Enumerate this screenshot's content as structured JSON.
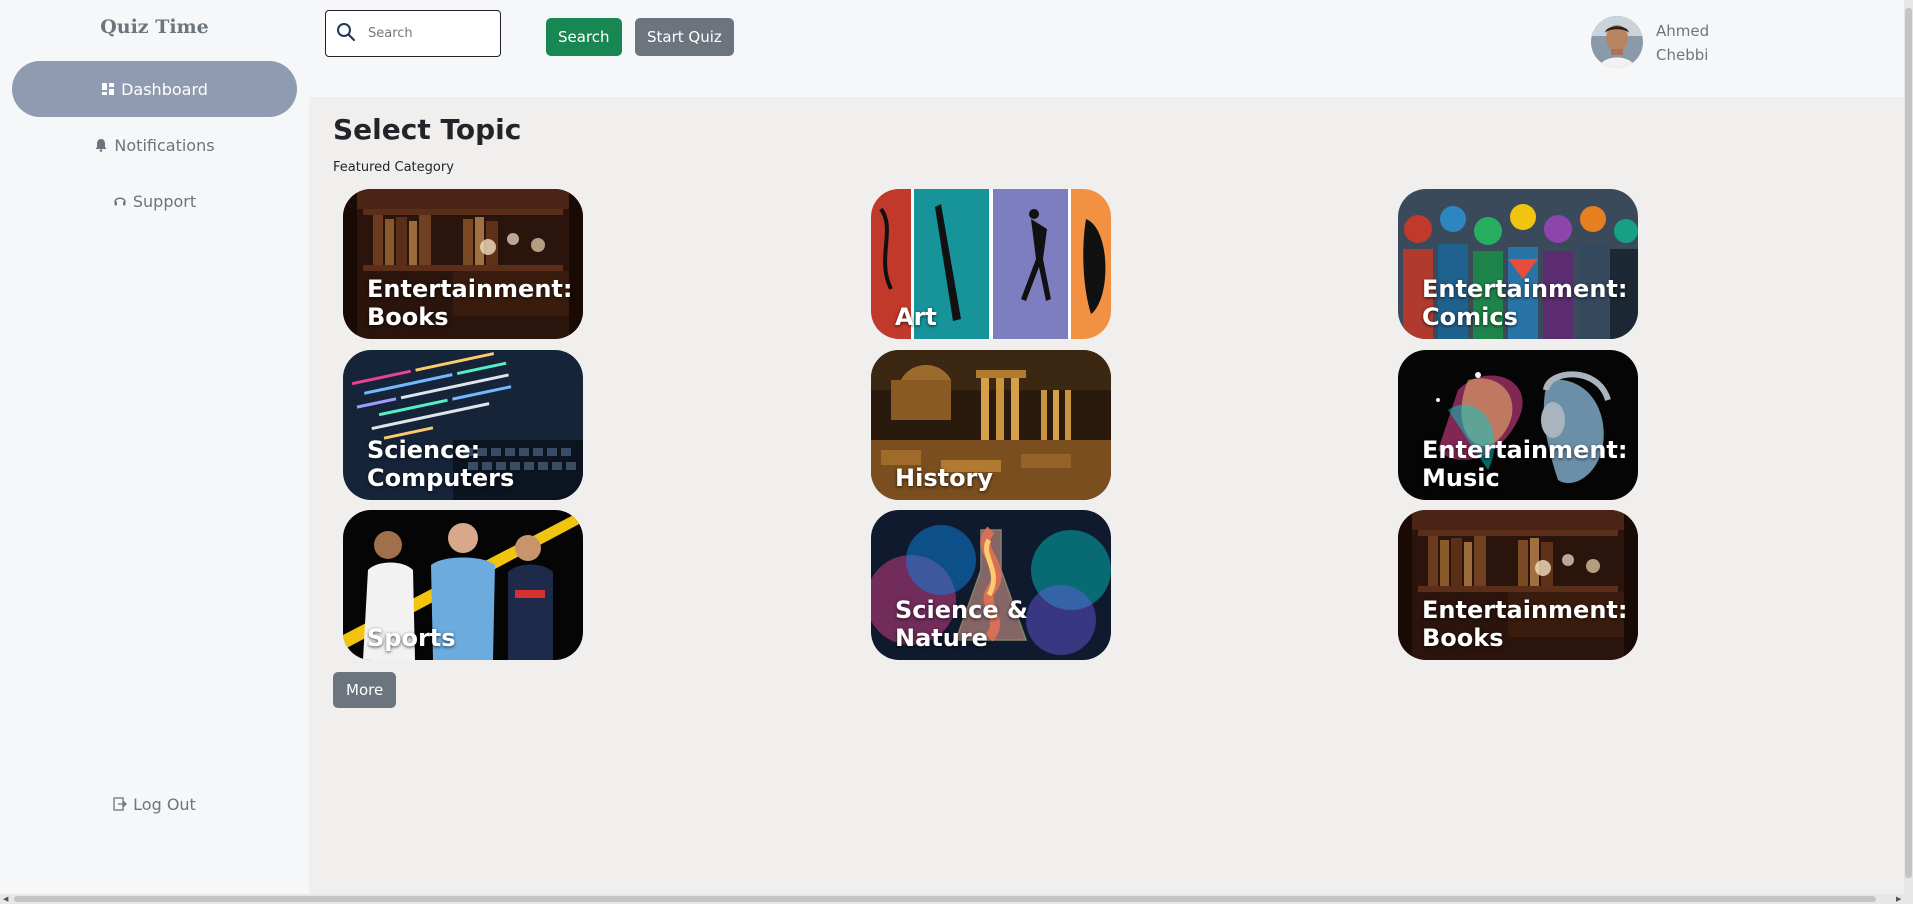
{
  "sidebar": {
    "brand": "Quiz Time",
    "items": [
      {
        "label": "Dashboard",
        "icon": "dashboard-icon",
        "active": true
      },
      {
        "label": "Notifications",
        "icon": "bell-icon"
      },
      {
        "label": "Support",
        "icon": "headset-icon"
      }
    ],
    "logout": {
      "label": "Log Out",
      "icon": "logout-icon"
    }
  },
  "header": {
    "search_placeholder": "Search",
    "search_button": "Search",
    "start_button": "Start Quiz",
    "user": {
      "first_name": "Ahmed",
      "last_name": "Chebbi",
      "avatar": "user-avatar"
    }
  },
  "main": {
    "title": "Select Topic",
    "subtitle": "Featured Category",
    "categories": [
      {
        "label": "Entertainment: Books",
        "image": "bookshelf-image"
      },
      {
        "label": "Art",
        "image": "art-panels-image"
      },
      {
        "label": "Entertainment: Comics",
        "image": "comic-heroes-image"
      },
      {
        "label": "Science: Computers",
        "image": "code-screen-image"
      },
      {
        "label": "History",
        "image": "ancient-ruins-image"
      },
      {
        "label": "Entertainment: Music",
        "image": "headphones-art-image"
      },
      {
        "label": "Sports",
        "image": "football-players-image"
      },
      {
        "label": "Science & Nature",
        "image": "chemistry-flask-image"
      },
      {
        "label": "Entertainment: Books",
        "image": "bookshelf-image"
      }
    ],
    "more_button": "More"
  },
  "colors": {
    "sidebar_bg": "#f6f7f9",
    "main_bg": "#f0efed",
    "active_nav": "#8e9bb0",
    "search_button": "#198754",
    "secondary_button": "#6c757d"
  }
}
